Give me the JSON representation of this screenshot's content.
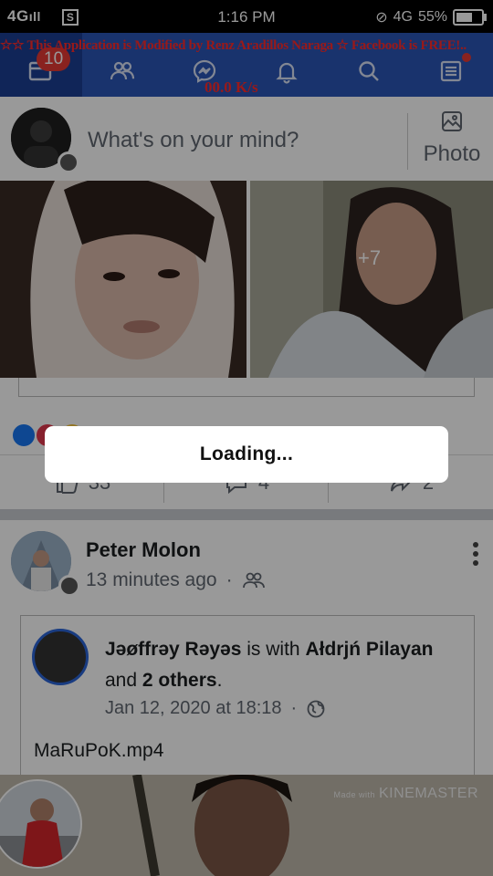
{
  "status_bar": {
    "network_left": "4G",
    "sim_icon_glyph": "S",
    "time": "1:16 PM",
    "network_right": "4G",
    "battery": "55%"
  },
  "navbar": {
    "banner": "☆☆ This Application is Modified by Renz Aradillos Naraga ☆ Facebook is FREE!..",
    "speed": "00.0 K/s",
    "notification_count": "10",
    "icons": [
      "news-feed-icon",
      "friends-icon",
      "messenger-icon",
      "notifications-bell-icon",
      "search-icon",
      "menu-icon"
    ]
  },
  "composer": {
    "placeholder": "What's on your mind?",
    "photo_label": "Photo"
  },
  "post1": {
    "more_photos": "+7",
    "like_count": "33",
    "comment_count": "4",
    "share_count": "2"
  },
  "post2": {
    "author": "Peter Molon",
    "time": "13 minutes ago",
    "dot": "·",
    "shared": {
      "author": "Jəøffrəy Rəyəs",
      "with_text": " is with ",
      "tagged": "Ałdrjń Pilayan",
      "and_text": "and ",
      "others": "2 others",
      "period": ".",
      "date": "Jan 12, 2020 at 18:18",
      "caption": "MaRuPoK.mp4"
    },
    "video_watermark_small": "Made with",
    "video_watermark": "KINEMASTER"
  },
  "dialog": {
    "text": "Loading..."
  },
  "colors": {
    "nav_blue": "#2b56b6",
    "banner_red": "#ff2a2a",
    "badge_red": "#e53935"
  }
}
